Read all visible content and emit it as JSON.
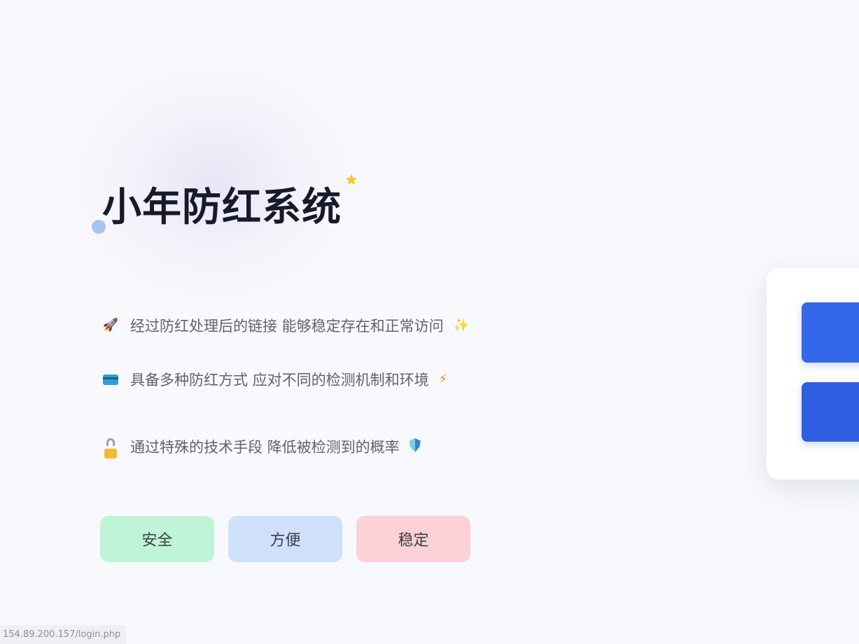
{
  "hero": {
    "title": "小年防红系统",
    "star_icon": "star-icon",
    "dot_color": "#a9c3f2"
  },
  "features": [
    {
      "icon": "rocket-icon",
      "text": "经过防红处理后的链接 能够稳定存在和正常访问",
      "tail_icon": "sparkles-icon"
    },
    {
      "icon": "credit-card-icon",
      "text": "具备多种防红方式 应对不同的检测机制和环境",
      "tail_icon": "lightning-icon"
    },
    {
      "icon": "lock-icon",
      "text": "通过特殊的技术手段 降低被检测到的概率",
      "tail_icon": "shield-icon"
    }
  ],
  "tags": [
    {
      "label": "安全",
      "color": "#bff5d6"
    },
    {
      "label": "方便",
      "color": "#cfe0fb"
    },
    {
      "label": "稳定",
      "color": "#fbd0d6"
    }
  ],
  "login_panel": {
    "button_color": "#3366e6"
  },
  "status_bar": {
    "url": "154.89.200.157/login.php"
  }
}
